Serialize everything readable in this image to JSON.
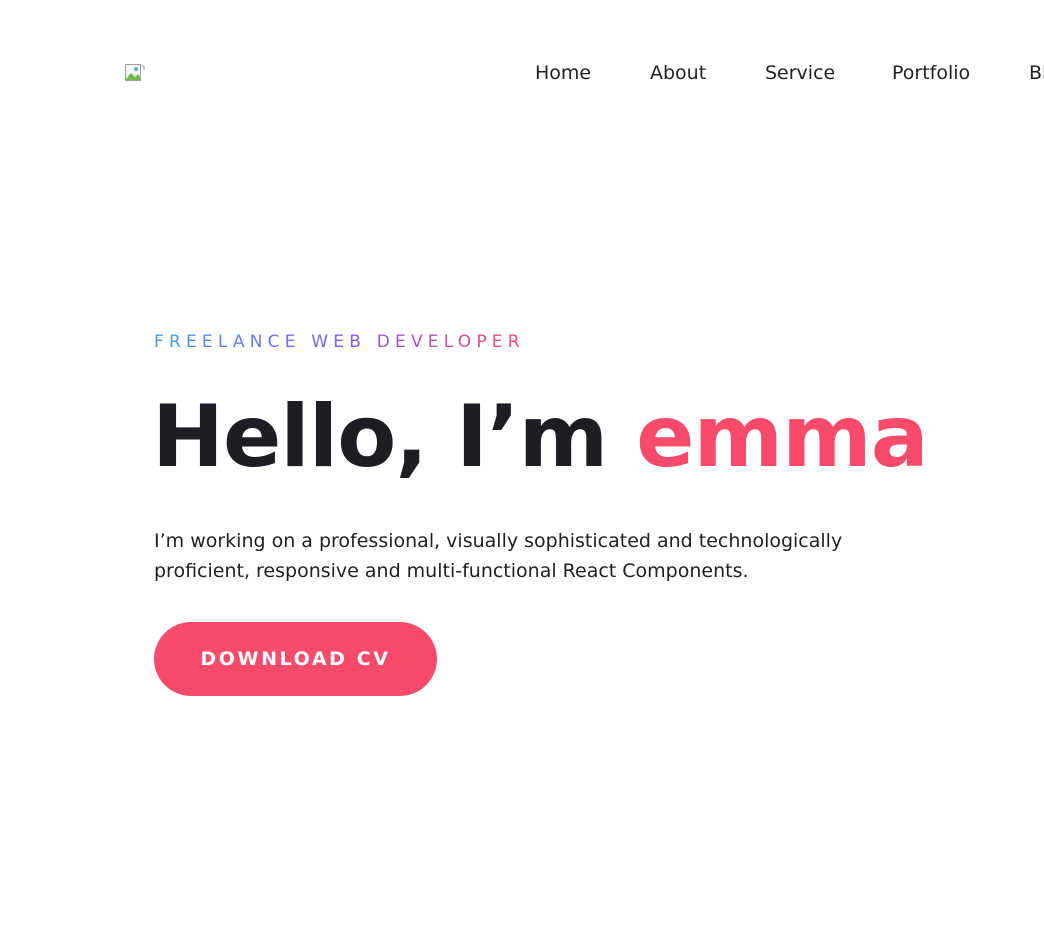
{
  "header": {
    "logo_icon": "broken-image-icon",
    "nav": [
      {
        "label": "Home"
      },
      {
        "label": "About"
      },
      {
        "label": "Service"
      },
      {
        "label": "Portfolio"
      },
      {
        "label": "Bl"
      }
    ]
  },
  "hero": {
    "eyebrow": "FREELANCE WEB DEVELOPER",
    "headline_prefix": "Hello, I’m ",
    "headline_name": "emma",
    "description": "I’m working on a professional, visually sophisticated and technologically proficient, responsive and multi-functional React Components.",
    "cta_label": "DOWNLOAD CV"
  },
  "colors": {
    "accent": "#f84b6c",
    "text": "#1f1f24",
    "gradient_start": "#3f9ef0",
    "gradient_mid": "#7b5cf3",
    "gradient_end": "#f2476f"
  }
}
